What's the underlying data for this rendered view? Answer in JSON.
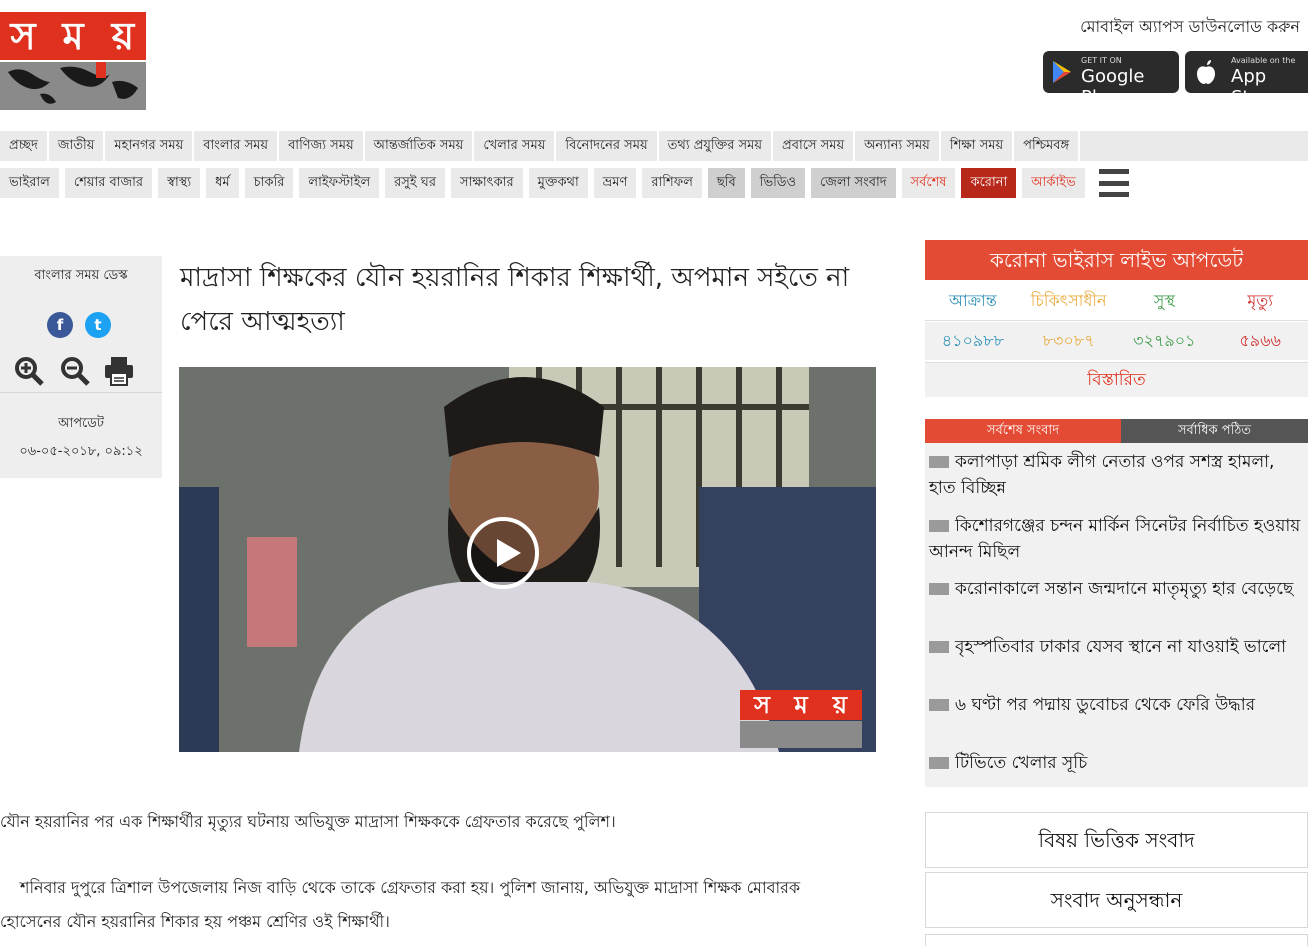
{
  "header": {
    "logo_letters": [
      "স",
      "ম",
      "য়"
    ],
    "app_download_text": "মোবাইল অ্যাপস ডাউনলোড করুন",
    "google_play": {
      "small": "GET IT ON",
      "big": "Google Play"
    },
    "app_store": {
      "small": "Available on the",
      "big": "App Store"
    }
  },
  "nav_primary": [
    "প্রচ্ছদ",
    "জাতীয়",
    "মহানগর সময়",
    "বাংলার সময়",
    "বাণিজ্য সময়",
    "আন্তর্জাতিক সময়",
    "খেলার সময়",
    "বিনোদনের সময়",
    "তথ্য প্রযুক্তির সময়",
    "প্রবাসে সময়",
    "অন্যান্য সময়",
    "শিক্ষা সময়",
    "পশ্চিমবঙ্গ"
  ],
  "nav_secondary": [
    "ভাইরাল",
    "শেয়ার বাজার",
    "স্বাস্থ্য",
    "ধর্ম",
    "চাকরি",
    "লাইফস্টাইল",
    "রসুই ঘর",
    "সাক্ষাৎকার",
    "মুক্তকথা",
    "ভ্রমণ",
    "রাশিফল",
    "ছবি",
    "ভিডিও",
    "জেলা সংবাদ",
    "সর্বশেষ",
    "করোনা",
    "আর্কাইভ"
  ],
  "meta": {
    "desk": "বাংলার সময় ডেস্ক",
    "update_label": "আপডেট",
    "update_date": "০৬-০৫-২০১৮, ০৯:১২"
  },
  "article": {
    "headline": "মাদ্রাসা শিক্ষকের যৌন হয়রানির শিকার শিক্ষার্থী, অপমান সইতে না পেরে আত্মহত্যা",
    "para1": "যৌন হয়রানির পর এক শিক্ষার্থীর মৃত্যুর ঘটনায় অভিযুক্ত মাদ্রাসা শিক্ষককে গ্রেফতার করেছে পুলিশ।",
    "para2_line1": "শনিবার দুপুরে ত্রিশাল উপজেলায় নিজ বাড়ি থেকে তাকে গ্রেফতার করা হয়। পুলিশ জানায়, অভিযুক্ত মাদ্রাসা শিক্ষক মোবারক",
    "para2_line2": "হোসেনের যৌন হয়রানির শিকার হয় পঞ্চম শ্রেণির ওই শিক্ষার্থী।"
  },
  "corona": {
    "title": "করোনা ভাইরাস লাইভ আপডেট",
    "labels": [
      "আক্রান্ত",
      "চিকিৎসাধীন",
      "সুস্থ",
      "মৃত্যু"
    ],
    "values": [
      "৪১০৯৮৮",
      "৮৩০৮৭",
      "৩২৭৯০১",
      "৫৯৬৬"
    ],
    "details": "বিস্তারিত",
    "colors": [
      "#2a8fb6",
      "#e8a93a",
      "#3a9a48",
      "#d02a2a"
    ]
  },
  "news_tabs": {
    "latest": "সর্বশেষ সংবাদ",
    "most_read": "সর্বাধিক পঠিত"
  },
  "news_items": [
    "কলাপাড়া শ্রমিক লীগ নেতার ওপর সশস্ত্র হামলা, হাত বিচ্ছিন্ন",
    "কিশোরগঞ্জের চন্দন মার্কিন সিনেটর নির্বাচিত হওয়ায় আনন্দ মিছিল",
    "করোনাকালে সন্তান জন্মদানে মাতৃমৃত্যু হার বেড়েছে",
    "বৃহস্পতিবার ঢাকার যেসব স্থানে না যাওয়াই ভালো",
    "৬ ঘণ্টা পর পদ্মায় ডুবোচর থেকে ফেরি উদ্ধার",
    "টিভিতে খেলার সূচি"
  ],
  "side_buttons": {
    "topic_news": "বিষয় ভিত্তিক সংবাদ",
    "news_search": "সংবাদ অনুসন্ধান"
  }
}
